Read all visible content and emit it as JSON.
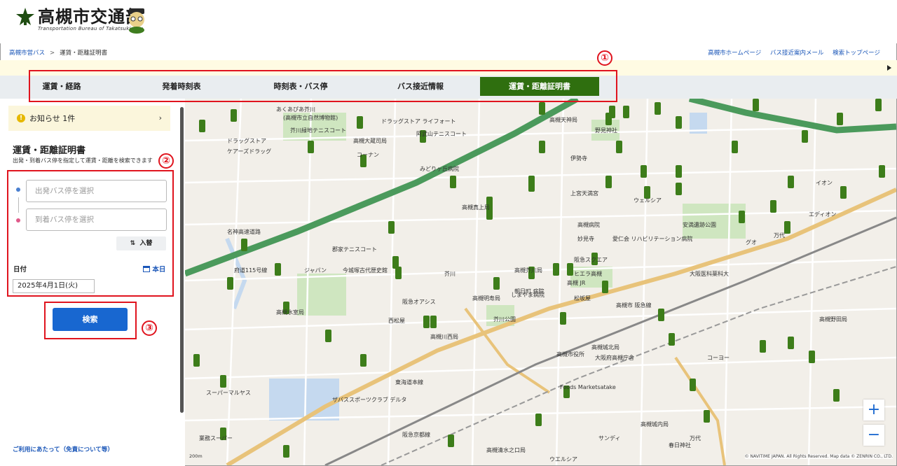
{
  "header": {
    "logo_title": "高槻市交通部",
    "logo_subtitle": "Transportation Bureau of Takatsuki City"
  },
  "breadcrumb": {
    "items": [
      "高槻市営バス",
      "運賃・距離証明書"
    ]
  },
  "top_links": [
    "高槻市ホームページ",
    "バス接近案内メール",
    "検索トップページ"
  ],
  "tabs": [
    {
      "label": "運賃・経路",
      "active": false
    },
    {
      "label": "発着時刻表",
      "active": false
    },
    {
      "label": "時刻表・バス停",
      "active": false
    },
    {
      "label": "バス接近情報",
      "active": false
    },
    {
      "label": "運賃・距離証明書",
      "active": true
    }
  ],
  "sidebar": {
    "notice_label": "お知らせ 1件",
    "title": "運賃・距離証明書",
    "description": "出発・到着バス停を指定して運賃・距離を検索できます",
    "departure_placeholder": "出発バス停を選択",
    "arrival_placeholder": "到着バス停を選択",
    "swap_label": "入替",
    "date_label": "日付",
    "today_label": "本日",
    "date_value": "2025年4月1日(火)",
    "search_label": "検索",
    "terms_link": "ご利用にあたって（免責について等）"
  },
  "annotations": [
    "①",
    "②",
    "③"
  ],
  "map": {
    "zoom_in": "+",
    "zoom_out": "−",
    "scale_label": "200m",
    "credit": "© NAVITIME JAPAN. All Rights Reserved. Map data © ZENRIN CO., LTD.",
    "labels": [
      "あくあぴあ芥川",
      "(高槻市立自然博物館)",
      "芥川緑地テニスコート",
      "ドラッグストア ライフォート",
      "阿武山テニスコート",
      "ケアーズドラッグ",
      "高槻大蔵司局",
      "コーナン",
      "ドラッグストア",
      "みどりヶ丘病院",
      "伊勢寺",
      "高槻天神局",
      "野見神社",
      "上宮天満宮",
      "ウェルシア",
      "高槻真上局",
      "高槻病院",
      "妙見寺",
      "愛仁会 リハビリテーション病院",
      "安満遺跡公園",
      "郡家テニスコート",
      "万代",
      "阪急スクエア",
      "ヒエラ高槻",
      "高槻芥川局",
      "高槻 JR",
      "ジャパン",
      "今城塚古代歴史館",
      "芥川",
      "朝日町 病院",
      "しまやま病院",
      "松坂屋",
      "高槻明寿局",
      "阪急オアシス",
      "大阪医科薬科大",
      "高槻市 阪急線",
      "高槻水室局",
      "芥川公園",
      "西松屋",
      "高槻川西局",
      "高槻市役所",
      "高槻城北局",
      "大阪府高槻庁舎",
      "高槻野田局",
      "Foods Marketsatake",
      "コーヨー",
      "ザバススポーツクラブ デルタ",
      "スーパーマルヤス",
      "業務スーパー",
      "高槻城内局",
      "高槻清水之口局",
      "サンディ",
      "春日神社",
      "ウエルシア",
      "万代",
      "イオン",
      "エディオン",
      "グオ",
      "名神高速道路",
      "府道115号線",
      "東海道本線",
      "阪急京都線"
    ]
  }
}
